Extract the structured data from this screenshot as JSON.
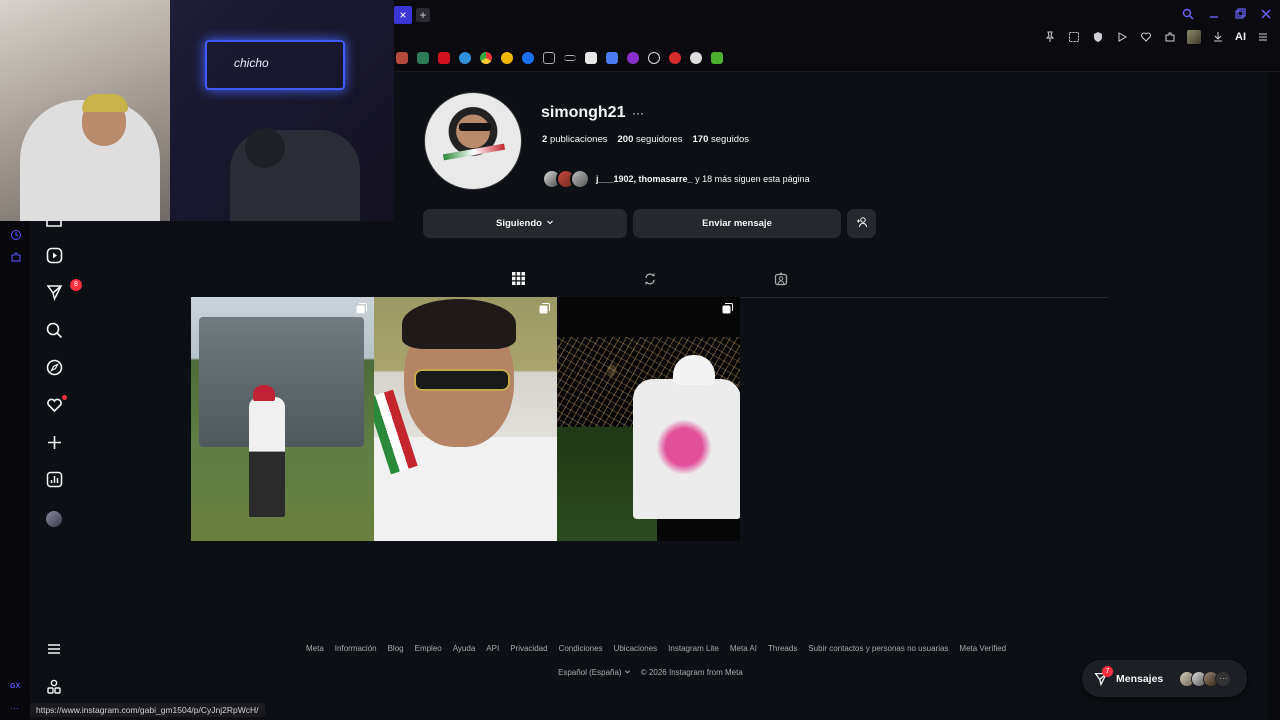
{
  "browser": {
    "tab_close": "×",
    "tab_new": "+",
    "ai_label": "AI",
    "accent": "#5a55ff"
  },
  "webcam": {
    "neon_text": "chicho"
  },
  "profile": {
    "username": "simongh21",
    "more": "···",
    "posts_count": "2",
    "posts_label": "publicaciones",
    "followers_count": "200",
    "followers_label": "seguidores",
    "following_count": "170",
    "following_label": "seguidos",
    "followed_by_names": "j___1902, thomasarre_",
    "followed_by_rest": " y 18 más siguen esta página"
  },
  "actions": {
    "following_label": "Siguiendo",
    "message_label": "Enviar mensaje"
  },
  "nav": {
    "notifications_badge": "8"
  },
  "footer": {
    "links": [
      "Meta",
      "Información",
      "Blog",
      "Empleo",
      "Ayuda",
      "API",
      "Privacidad",
      "Condiciones",
      "Ubicaciones",
      "Instagram Lite",
      "Meta AI",
      "Threads",
      "Subir contactos y personas no usuarias",
      "Meta Verified"
    ],
    "language": "Español (España)",
    "copyright": "© 2026 Instagram from Meta"
  },
  "status_bar": {
    "url": "https://www.instagram.com/gabi_gm1504/p/CyJnj2RpWcH/"
  },
  "sidebar_gx": {
    "label": "GX",
    "more": "···"
  },
  "messages": {
    "label": "Mensajes",
    "badge": "7",
    "more": "···"
  }
}
